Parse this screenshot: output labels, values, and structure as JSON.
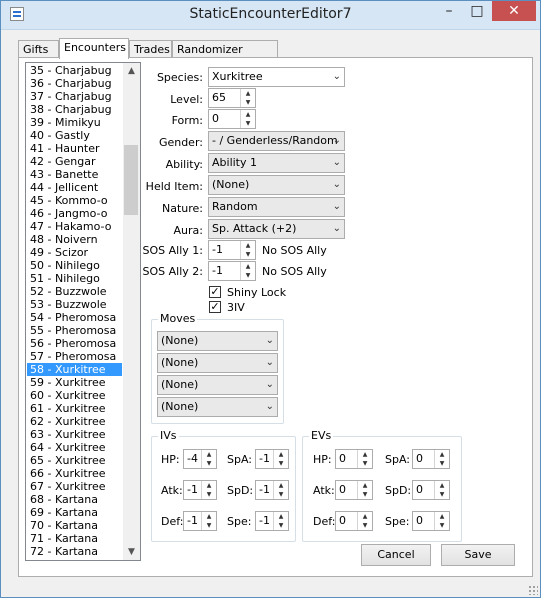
{
  "window": {
    "title": "StaticEncounterEditor7",
    "minimize": "–",
    "maximize": "□",
    "close": "✕"
  },
  "tabs": [
    "Gifts",
    "Encounters",
    "Trades",
    "Randomizer Options"
  ],
  "list": {
    "items": [
      "35 - Charjabug",
      "36 - Charjabug",
      "37 - Charjabug",
      "38 - Charjabug",
      "39 - Mimikyu",
      "40 - Gastly",
      "41 - Haunter",
      "42 - Gengar",
      "43 - Banette",
      "44 - Jellicent",
      "45 - Kommo-o",
      "46 - Jangmo-o",
      "47 - Hakamo-o",
      "48 - Noivern",
      "49 - Scizor",
      "50 - Nihilego",
      "51 - Nihilego",
      "52 - Buzzwole",
      "53 - Buzzwole",
      "54 - Pheromosa",
      "55 - Pheromosa",
      "56 - Pheromosa",
      "57 - Pheromosa",
      "58 - Xurkitree",
      "59 - Xurkitree",
      "60 - Xurkitree",
      "61 - Xurkitree",
      "62 - Xurkitree",
      "63 - Xurkitree",
      "64 - Xurkitree",
      "65 - Xurkitree",
      "66 - Xurkitree",
      "67 - Xurkitree",
      "68 - Kartana",
      "69 - Kartana",
      "70 - Kartana",
      "71 - Kartana",
      "72 - Kartana"
    ],
    "selected": "58 - Xurkitree",
    "scroll_up": "▲",
    "scroll_down": "▼"
  },
  "form": {
    "species_label": "Species:",
    "species": "Xurkitree",
    "level_label": "Level:",
    "level": "65",
    "form_label": "Form:",
    "form": "0",
    "gender_label": "Gender:",
    "gender": "- / Genderless/Random",
    "ability_label": "Ability:",
    "ability": "Ability 1",
    "held_item_label": "Held Item:",
    "held_item": "(None)",
    "nature_label": "Nature:",
    "nature": "Random",
    "aura_label": "Aura:",
    "aura": "Sp. Attack (+2)",
    "sos1_label": "SOS Ally 1:",
    "sos1": "-1",
    "sos1_text": "No SOS Ally",
    "sos2_label": "SOS Ally 2:",
    "sos2": "-1",
    "sos2_text": "No SOS Ally",
    "shiny_lock": "Shiny Lock",
    "three_iv": "3IV",
    "check_mark": "✓",
    "dropdown_arrow": "⌄",
    "spin_up": "▲",
    "spin_down": "▼"
  },
  "moves": {
    "title": "Moves",
    "values": [
      "(None)",
      "(None)",
      "(None)",
      "(None)"
    ]
  },
  "ivs": {
    "title": "IVs",
    "hp_label": "HP:",
    "hp": "-4",
    "atk_label": "Atk:",
    "atk": "-1",
    "def_label": "Def:",
    "def": "-1",
    "spa_label": "SpA:",
    "spa": "-1",
    "spd_label": "SpD:",
    "spd": "-1",
    "spe_label": "Spe:",
    "spe": "-1"
  },
  "evs": {
    "title": "EVs",
    "hp_label": "HP:",
    "hp": "0",
    "atk_label": "Atk:",
    "atk": "0",
    "def_label": "Def:",
    "def": "0",
    "spa_label": "SpA:",
    "spa": "0",
    "spd_label": "SpD:",
    "spd": "0",
    "spe_label": "Spe:",
    "spe": "0"
  },
  "buttons": {
    "cancel": "Cancel",
    "save": "Save"
  }
}
